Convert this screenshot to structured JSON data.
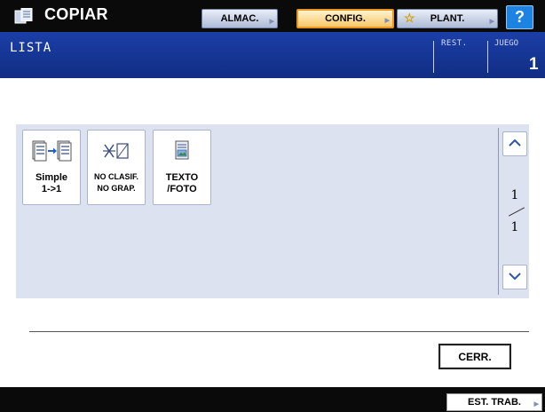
{
  "header": {
    "title": "COPIAR",
    "app_icon": "copier-icon",
    "buttons": [
      {
        "label": "ALMAC.",
        "state": "normal"
      },
      {
        "label": "CONFIG.",
        "state": "selected"
      },
      {
        "label": "PLANT.",
        "icon": "star-icon",
        "state": "normal"
      }
    ],
    "help_label": "?"
  },
  "status": {
    "label": "LISTA",
    "rest_label": "REST.",
    "juego_label": "JUEGO",
    "juego_value": "1"
  },
  "functions": [
    {
      "icon": "simplex-copy-icon",
      "line1": "Simple",
      "line2": "1->1"
    },
    {
      "icon": "no-sort-no-staple-icon",
      "line1": "NO CLASIF.",
      "line2": "NO GRAP."
    },
    {
      "icon": "text-photo-icon",
      "line1": "TEXTO",
      "line2": "/FOTO"
    }
  ],
  "pagination": {
    "current": "1",
    "total": "1"
  },
  "close_label": "CERR.",
  "job_status_label": "EST. TRAB.",
  "colors": {
    "status_bar": "#1b3fa7",
    "panel": "#dde2f1",
    "selected_border": "#e8961f",
    "help": "#1c83e2"
  }
}
